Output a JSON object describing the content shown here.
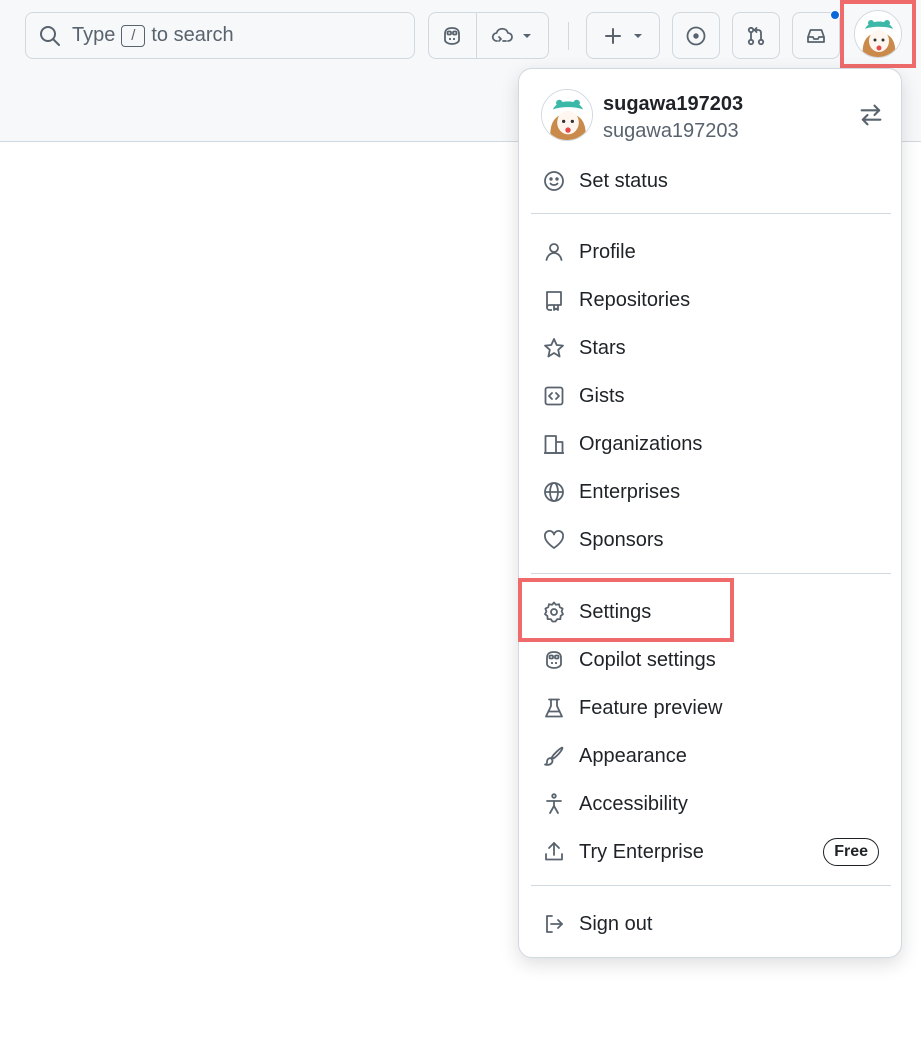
{
  "search": {
    "prefix": "Type",
    "key": "/",
    "suffix": "to search"
  },
  "header": {
    "icons": [
      "search-icon",
      "copilot-icon",
      "codespaces-icon",
      "chevron-down-icon",
      "plus-icon",
      "issue-icon",
      "pull-request-icon",
      "inbox-icon"
    ]
  },
  "user": {
    "name": "sugawa197203",
    "handle": "sugawa197203"
  },
  "menu": {
    "set_status": "Set status",
    "profile": "Profile",
    "repositories": "Repositories",
    "stars": "Stars",
    "gists": "Gists",
    "organizations": "Organizations",
    "enterprises": "Enterprises",
    "sponsors": "Sponsors",
    "settings": "Settings",
    "copilot_settings": "Copilot settings",
    "feature_preview": "Feature preview",
    "appearance": "Appearance",
    "accessibility": "Accessibility",
    "try_enterprise": "Try Enterprise",
    "try_enterprise_badge": "Free",
    "sign_out": "Sign out"
  },
  "colors": {
    "highlight": "#ef6b6b",
    "notification_dot": "#0969da",
    "icon": "#59636e",
    "text": "#1f2328"
  }
}
